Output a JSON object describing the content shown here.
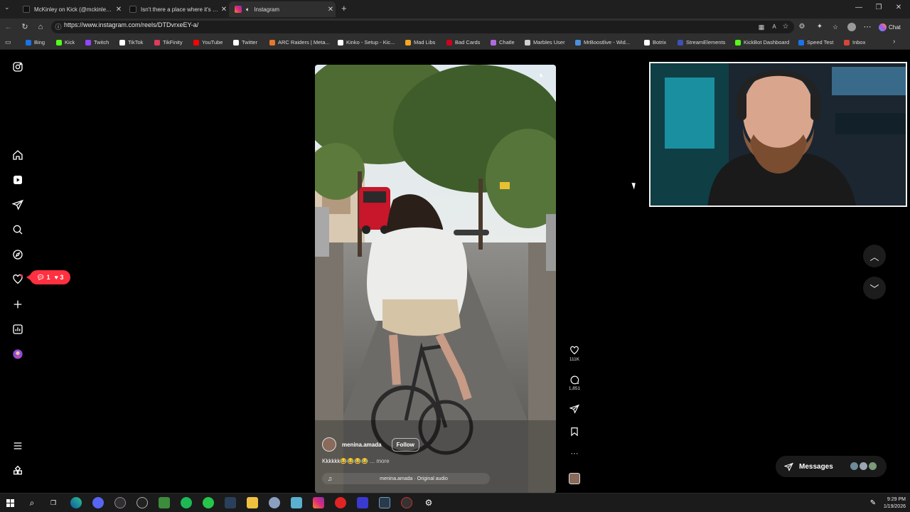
{
  "browser": {
    "tabs": [
      {
        "title": "McKinley on Kick (@mckinley.tv) |",
        "icon": "tiktok-icon",
        "active": false
      },
      {
        "title": "Isn't there a place where it's comm",
        "icon": "tiktok-icon",
        "active": false
      },
      {
        "title": "Instagram",
        "icon": "instagram-icon",
        "active": true
      }
    ],
    "url": "https://www.instagram.com/reels/DTDvrxeEY-a/",
    "chat_label": "Chat",
    "bookmarks": [
      {
        "label": "Bing",
        "color": "#1a73e8"
      },
      {
        "label": "Kick",
        "color": "#53fc18"
      },
      {
        "label": "Twitch",
        "color": "#9146ff"
      },
      {
        "label": "TikTok",
        "color": "#ffffff"
      },
      {
        "label": "TikFinity",
        "color": "#e03a5e"
      },
      {
        "label": "YouTube",
        "color": "#ff0000"
      },
      {
        "label": "Twitter",
        "color": "#ffffff"
      },
      {
        "label": "ARC Raiders | Meta...",
        "color": "#e8762b"
      },
      {
        "label": "Kinko - Setup - Kic...",
        "color": "#ffffff"
      },
      {
        "label": "Mad Libs",
        "color": "#f5a623"
      },
      {
        "label": "Bad Cards",
        "color": "#d0021b"
      },
      {
        "label": "Chatle",
        "color": "#b06adf"
      },
      {
        "label": "Marbles User",
        "color": "#cfcfcf"
      },
      {
        "label": "MrBoostlive - Wid...",
        "color": "#4a90e2"
      },
      {
        "label": "Botrix",
        "color": "#ffffff"
      },
      {
        "label": "StreamElements",
        "color": "#3f51b5"
      },
      {
        "label": "KickBot Dashboard",
        "color": "#53fc18"
      },
      {
        "label": "Speed Test",
        "color": "#1a73e8"
      },
      {
        "label": "Inbox",
        "color": "#d44638"
      }
    ]
  },
  "notifications": {
    "comments": "1",
    "likes": "3"
  },
  "reel": {
    "username": "menina.amada",
    "follow_label": "Follow",
    "caption": "Kkkkkk😂😂😂😂",
    "more_label": "... more",
    "audio": "menina.amada · Original audio",
    "likes": "111K",
    "comments": "1,851"
  },
  "messages_label": "Messages",
  "clock": {
    "time": "9:29 PM",
    "date": "1/19/2026"
  },
  "colors": {
    "accent": "#ff3040",
    "background": "#000000"
  }
}
